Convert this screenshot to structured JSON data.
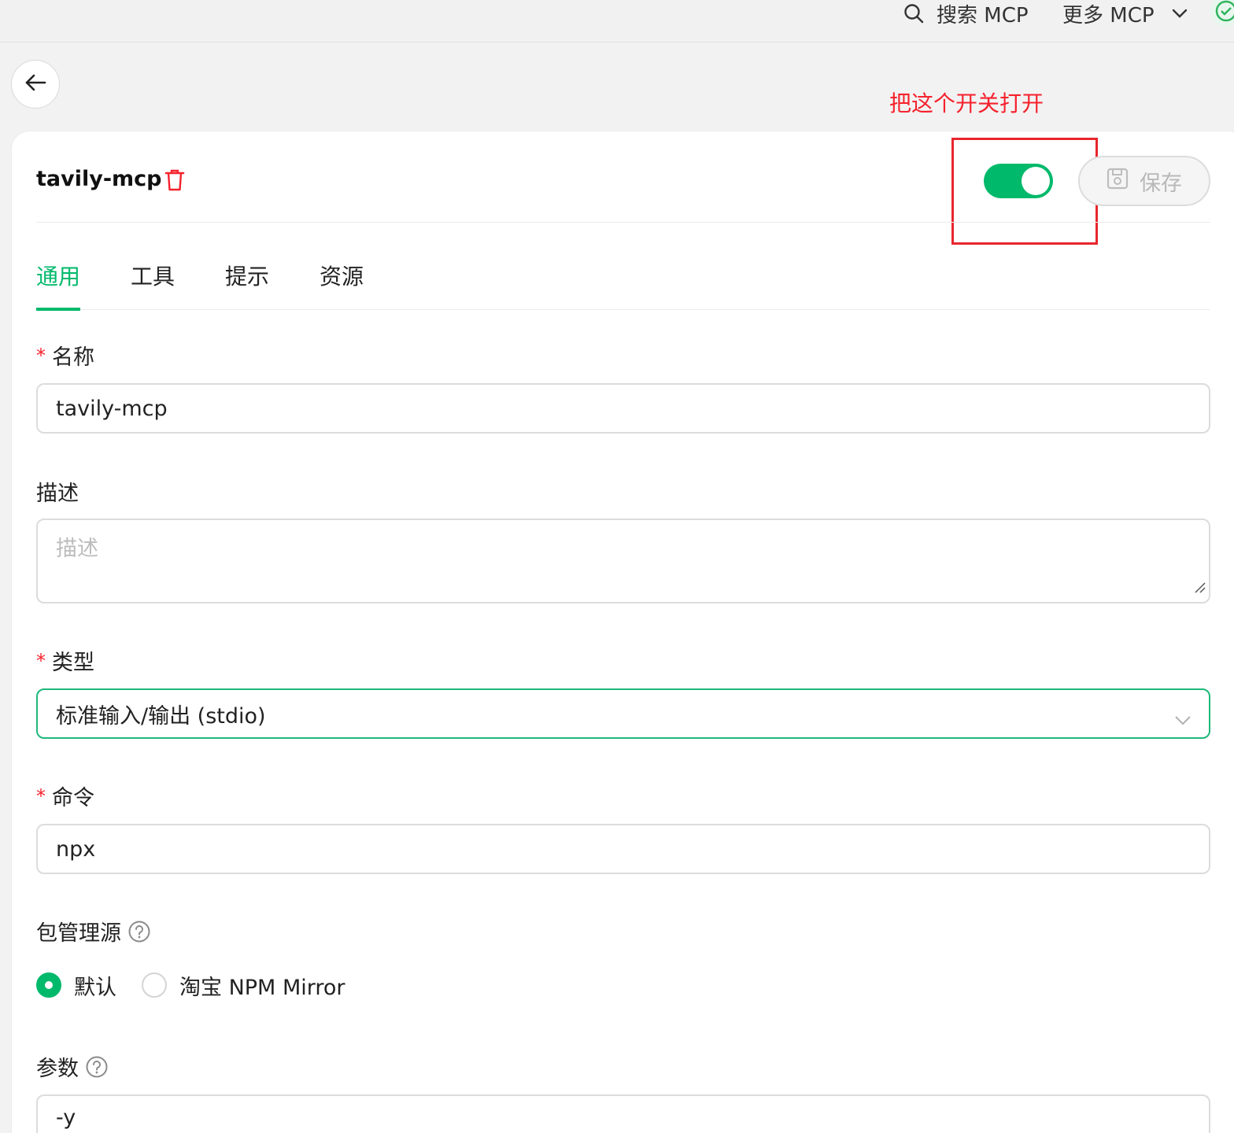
{
  "topbar": {
    "search_label": "搜索 MCP",
    "more_label": "更多 MCP",
    "search_icon": "search-icon",
    "more_icon": "chevron-down-icon",
    "status_icon": "check-circle-icon"
  },
  "annotation": {
    "text": "把这个开关打开",
    "color": "#f5222d"
  },
  "server": {
    "title": "tavily-mcp",
    "enabled": true,
    "save_label": "保存",
    "delete_icon": "trash-icon",
    "save_icon": "save-icon"
  },
  "tabs": [
    {
      "label": "通用",
      "active": true
    },
    {
      "label": "工具",
      "active": false
    },
    {
      "label": "提示",
      "active": false
    },
    {
      "label": "资源",
      "active": false
    }
  ],
  "form": {
    "required_mark": "*",
    "name": {
      "label": "名称",
      "value": "tavily-mcp"
    },
    "description": {
      "label": "描述",
      "placeholder": "描述",
      "value": ""
    },
    "type": {
      "label": "类型",
      "value": "标准输入/输出 (stdio)"
    },
    "command": {
      "label": "命令",
      "value": "npx"
    },
    "registry": {
      "label": "包管理源",
      "options": [
        {
          "label": "默认",
          "checked": true
        },
        {
          "label": "淘宝 NPM Mirror",
          "checked": false
        }
      ]
    },
    "args": {
      "label": "参数",
      "value": "-y"
    }
  },
  "colors": {
    "accent": "#00b96b",
    "danger": "#f5222d"
  }
}
